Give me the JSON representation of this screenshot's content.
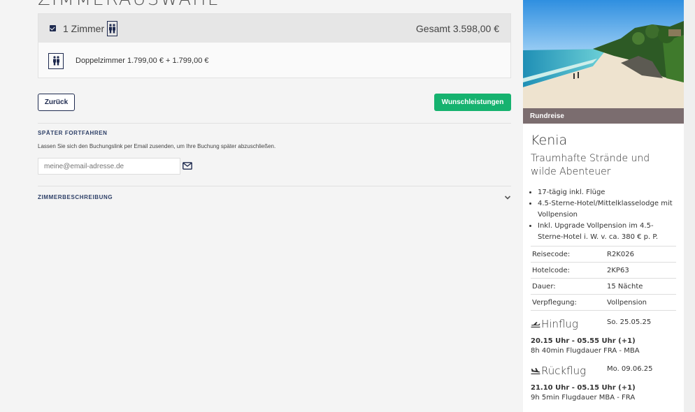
{
  "main": {
    "title": "ZIMMERAUSWAHL",
    "room_selection": {
      "count_label": "1 Zimmer",
      "total_label": "Gesamt 3.598,00 €",
      "line_description": "Doppelzimmer 1.799,00 € + 1.799,00 €"
    },
    "back_button": "Zurück",
    "next_button": "Wunschleistungen",
    "later": {
      "heading": "SPÄTER FORTFAHREN",
      "text": "Lassen Sie sich den Buchungslink per Email zusenden, um Ihre Buchung später abzuschließen.",
      "email_placeholder": "meine@email-adresse.de"
    },
    "room_description_heading": "ZIMMERBESCHREIBUNG"
  },
  "colors": {
    "navy": "#1e2a4f",
    "green_button": "#16b26f",
    "tag_bar": "#7b6d6f"
  },
  "sidebar": {
    "tag": "Rundreise",
    "destination": "Kenia",
    "subtitle": "Traumhafte Strände und wilde Abenteuer",
    "features": [
      "17-tägig inkl. Flüge",
      "4.5-Sterne-Hotel/Mittelklasselodge mit Vollpension",
      "Inkl. Upgrade Vollpension im 4.5-Sterne-Hotel i. W. v. ca. 380 € p. P."
    ],
    "info": [
      {
        "label": "Reisecode:",
        "value": "R2K026"
      },
      {
        "label": "Hotelcode:",
        "value": "2KP63"
      },
      {
        "label": "Dauer:",
        "value": "15 Nächte"
      },
      {
        "label": "Verpflegung:",
        "value": "Vollpension"
      }
    ],
    "outbound": {
      "title": "Hinflug",
      "date": "So. 25.05.25",
      "time": "20.15 Uhr - 05.55 Uhr (+1)",
      "duration": "8h 40min Flugdauer FRA - MBA"
    },
    "return": {
      "title": "Rückflug",
      "date": "Mo. 09.06.25",
      "time": "21.10 Uhr - 05.15 Uhr (+1)",
      "duration": "9h 5min Flugdauer MBA - FRA"
    }
  }
}
